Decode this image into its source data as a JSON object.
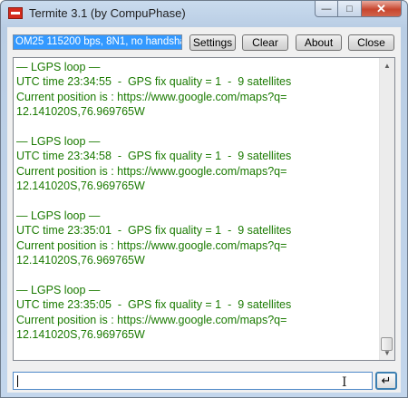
{
  "window": {
    "title": "Termite 3.1 (by CompuPhase)",
    "app_icon": "termite-app-icon",
    "controls": {
      "minimize": "—",
      "maximize": "□",
      "close": "✕"
    }
  },
  "toolbar": {
    "port_settings": "OM25 115200 bps, 8N1, no handshak",
    "settings_label": "Settings",
    "clear_label": "Clear",
    "about_label": "About",
    "close_label": "Close"
  },
  "output": {
    "text_color": "#1a7a00",
    "lines": [
      "— LGPS loop —",
      "UTC time 23:34:55  -  GPS fix quality = 1  -  9 satellites",
      "Current position is : https://www.google.com/maps?q=",
      "12.141020S,76.969765W",
      "",
      "— LGPS loop —",
      "UTC time 23:34:58  -  GPS fix quality = 1  -  9 satellites",
      "Current position is : https://www.google.com/maps?q=",
      "12.141020S,76.969765W",
      "",
      "— LGPS loop —",
      "UTC time 23:35:01  -  GPS fix quality = 1  -  9 satellites",
      "Current position is : https://www.google.com/maps?q=",
      "12.141020S,76.969765W",
      "",
      "— LGPS loop —",
      "UTC time 23:35:05  -  GPS fix quality = 1  -  9 satellites",
      "Current position is : https://www.google.com/maps?q=",
      "12.141020S,76.969765W"
    ]
  },
  "send": {
    "value": "",
    "enter_glyph": "↵"
  }
}
